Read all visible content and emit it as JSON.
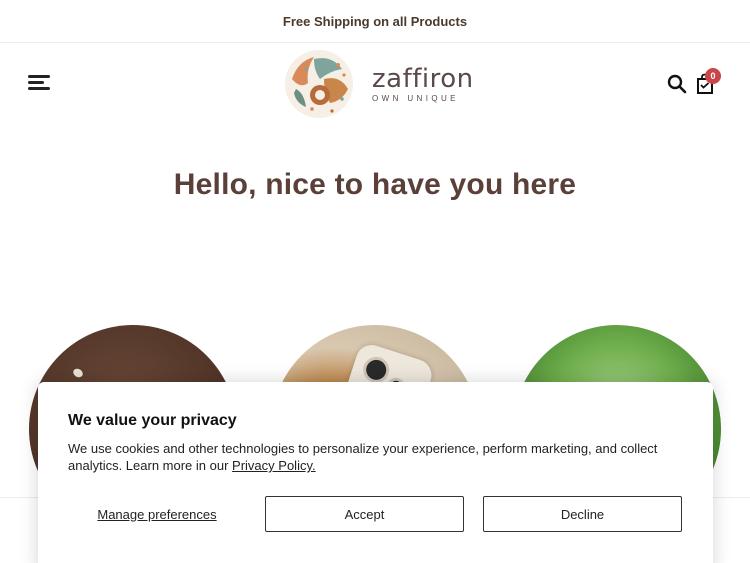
{
  "announcement": {
    "text": "Free Shipping on all Products"
  },
  "header": {
    "menu_icon": "hamburger-menu-icon",
    "logo": {
      "name": "zaffiron",
      "tagline": "OWN UNIQUE"
    },
    "search_icon": "search-icon",
    "cart_icon": "shopping-bag-icon",
    "cart_count": "0"
  },
  "hero": {
    "title": "Hello, nice to have you here"
  },
  "colors": {
    "accent_badge": "#c8454a",
    "title_brown": "#5a4038",
    "announcement_text": "#4a3a2d"
  },
  "privacy": {
    "title": "We value your privacy",
    "text": "We use cookies and other technologies to personalize your experience, perform marketing, and collect analytics. Learn more in our",
    "link": "Privacy Policy.",
    "manage": "Manage preferences",
    "accept": "Accept",
    "decline": "Decline"
  }
}
